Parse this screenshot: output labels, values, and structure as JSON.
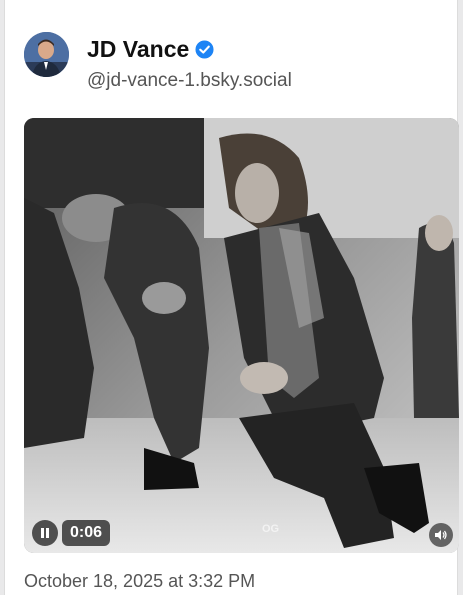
{
  "post": {
    "author_name": "JD Vance",
    "handle": "@jd-vance-1.bsky.social",
    "timestamp": "October 18, 2025 at 3:32 PM",
    "verified_color": "#1d84f5"
  },
  "video": {
    "time": "0:06",
    "watermark": "OG",
    "pause_icon": "pause-icon",
    "volume_icon": "speaker-icon"
  },
  "icons": {
    "verified": "verified-check-icon"
  }
}
